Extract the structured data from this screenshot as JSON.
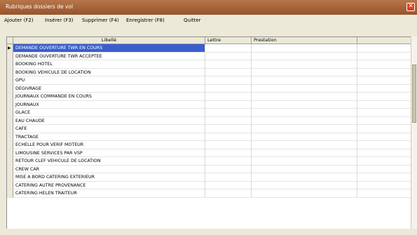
{
  "window": {
    "title": "Rubriques dossiers de vol",
    "close_glyph": "✕"
  },
  "menu": {
    "items": [
      {
        "label": "Ajouter (F2)"
      },
      {
        "label": "Insérer (F3)"
      },
      {
        "label": "Supprimer (F4)"
      },
      {
        "label": "Enregistrer (F8)"
      },
      {
        "label": "Quitter"
      }
    ]
  },
  "grid": {
    "columns": {
      "libelle": "Libellé",
      "lettre": "Lettre",
      "prestation": "Prestation"
    },
    "current_row_marker": "▶",
    "rows": [
      {
        "libelle": "DEMANDE OUVERTURE TWR  EN COURS",
        "lettre": "",
        "prestation": ""
      },
      {
        "libelle": "DEMANDE OUVERTURE  TWR  ACCEPTEE",
        "lettre": "",
        "prestation": ""
      },
      {
        "libelle": "BOOKING HOTEL",
        "lettre": "",
        "prestation": ""
      },
      {
        "libelle": "BOOKING  VEHICULE  DE LOCATION",
        "lettre": "",
        "prestation": ""
      },
      {
        "libelle": "GPU",
        "lettre": "",
        "prestation": ""
      },
      {
        "libelle": "DEGIVRAGE",
        "lettre": "",
        "prestation": ""
      },
      {
        "libelle": "JOURNAUX  COMMANDE  EN COURS",
        "lettre": "",
        "prestation": ""
      },
      {
        "libelle": "JOURNAUX",
        "lettre": "",
        "prestation": ""
      },
      {
        "libelle": "GLACE",
        "lettre": "",
        "prestation": ""
      },
      {
        "libelle": "EAU  CHAUDE",
        "lettre": "",
        "prestation": ""
      },
      {
        "libelle": "CAFE",
        "lettre": "",
        "prestation": ""
      },
      {
        "libelle": "TRACTAGE",
        "lettre": "",
        "prestation": ""
      },
      {
        "libelle": "ECHELLE  POUR VERIF MOTEUR",
        "lettre": "",
        "prestation": ""
      },
      {
        "libelle": "LIMOUSINE  SERVICES  PAR  VSP",
        "lettre": "",
        "prestation": ""
      },
      {
        "libelle": "RETOUR  CLEF  VEHICULE DE LOCATION",
        "lettre": "",
        "prestation": ""
      },
      {
        "libelle": "CREW  CAR",
        "lettre": "",
        "prestation": ""
      },
      {
        "libelle": "MISE  A  BORD  CATERING  EXTERIEUR",
        "lettre": "",
        "prestation": ""
      },
      {
        "libelle": "CATERING  AUTRE  PROVENANCE",
        "lettre": "",
        "prestation": ""
      },
      {
        "libelle": "CATERING  HELEN  TRAITEUR",
        "lettre": "",
        "prestation": ""
      }
    ]
  },
  "colors": {
    "titlebar": "#a4613a",
    "selection": "#3a5fcd",
    "close_button": "#d9411e"
  }
}
